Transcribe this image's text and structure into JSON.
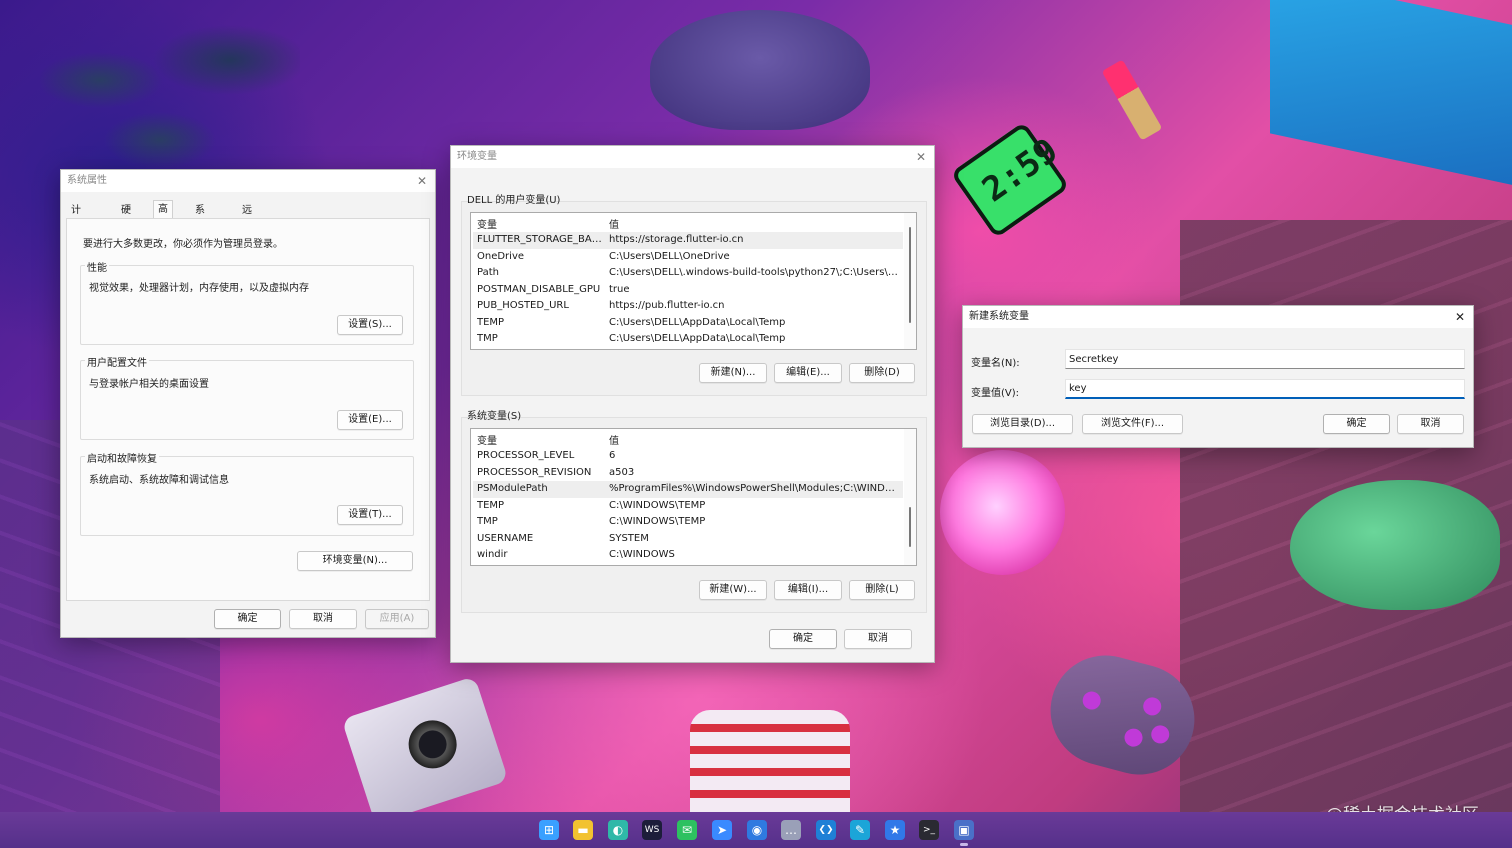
{
  "wallpaper": {
    "clock_text": "2:59",
    "watermark": "@稀土掘金技术社区"
  },
  "system_properties": {
    "title": "系统属性",
    "close_glyph": "✕",
    "tabs": [
      "计算机名",
      "硬件",
      "高级",
      "系统保护",
      "远程"
    ],
    "selected_tab": "高级",
    "admin_notice": "要进行大多数更改，你必须作为管理员登录。",
    "groups": [
      {
        "legend": "性能",
        "description": "视觉效果，处理器计划，内存使用，以及虚拟内存",
        "button": "设置(S)..."
      },
      {
        "legend": "用户配置文件",
        "description": "与登录帐户相关的桌面设置",
        "button": "设置(E)..."
      },
      {
        "legend": "启动和故障恢复",
        "description": "系统启动、系统故障和调试信息",
        "button": "设置(T)..."
      }
    ],
    "env_button": "环境变量(N)...",
    "ok": "确定",
    "cancel": "取消",
    "apply": "应用(A)"
  },
  "env_vars": {
    "title": "环境变量",
    "close_glyph": "✕",
    "user_section_label": "DELL 的用户变量(U)",
    "system_section_label": "系统变量(S)",
    "col_name": "变量",
    "col_value": "值",
    "user_vars": [
      {
        "name": "FLUTTER_STORAGE_BASE_...",
        "value": "https://storage.flutter-io.cn"
      },
      {
        "name": "OneDrive",
        "value": "C:\\Users\\DELL\\OneDrive"
      },
      {
        "name": "Path",
        "value": "C:\\Users\\DELL\\.windows-build-tools\\python27\\;C:\\Users\\DELL..."
      },
      {
        "name": "POSTMAN_DISABLE_GPU",
        "value": "true"
      },
      {
        "name": "PUB_HOSTED_URL",
        "value": "https://pub.flutter-io.cn"
      },
      {
        "name": "TEMP",
        "value": "C:\\Users\\DELL\\AppData\\Local\\Temp"
      },
      {
        "name": "TMP",
        "value": "C:\\Users\\DELL\\AppData\\Local\\Temp"
      }
    ],
    "system_vars": [
      {
        "name": "PROCESSOR_LEVEL",
        "value": "6"
      },
      {
        "name": "PROCESSOR_REVISION",
        "value": "a503"
      },
      {
        "name": "PSModulePath",
        "value": "%ProgramFiles%\\WindowsPowerShell\\Modules;C:\\WINDOW..."
      },
      {
        "name": "TEMP",
        "value": "C:\\WINDOWS\\TEMP"
      },
      {
        "name": "TMP",
        "value": "C:\\WINDOWS\\TEMP"
      },
      {
        "name": "USERNAME",
        "value": "SYSTEM"
      },
      {
        "name": "windir",
        "value": "C:\\WINDOWS"
      }
    ],
    "user_buttons": {
      "new": "新建(N)...",
      "edit": "编辑(E)...",
      "delete": "删除(D)"
    },
    "system_buttons": {
      "new": "新建(W)...",
      "edit": "编辑(I)...",
      "delete": "删除(L)"
    },
    "ok": "确定",
    "cancel": "取消"
  },
  "new_var": {
    "title": "新建系统变量",
    "close_glyph": "✕",
    "name_label": "变量名(N):",
    "value_label": "变量值(V):",
    "name_value": "Secretkey",
    "value_value": "key",
    "browse_dir": "浏览目录(D)...",
    "browse_file": "浏览文件(F)...",
    "ok": "确定",
    "cancel": "取消"
  },
  "taskbar": {
    "icons": [
      {
        "name": "windows-start-icon",
        "glyph": "⊞",
        "color": "#3aa0ff"
      },
      {
        "name": "file-explorer-icon",
        "glyph": "▬",
        "color": "#f2c230"
      },
      {
        "name": "edge-browser-icon",
        "glyph": "◐",
        "color": "#2fb8a8"
      },
      {
        "name": "webstorm-icon",
        "glyph": "WS",
        "color": "#1d1d3a"
      },
      {
        "name": "wechat-icon",
        "glyph": "✉",
        "color": "#2dc160"
      },
      {
        "name": "feishu-icon",
        "glyph": "➤",
        "color": "#3a8aff"
      },
      {
        "name": "location-app-icon",
        "glyph": "◉",
        "color": "#2f7ae0"
      },
      {
        "name": "chat-bubble-icon",
        "glyph": "…",
        "color": "#9aa0b8"
      },
      {
        "name": "vscode-icon",
        "glyph": "❮❯",
        "color": "#1f80d6"
      },
      {
        "name": "notes-app-icon",
        "glyph": "✎",
        "color": "#1ba5d8"
      },
      {
        "name": "star-app-icon",
        "glyph": "★",
        "color": "#3178e8"
      },
      {
        "name": "terminal-icon",
        "glyph": ">_",
        "color": "#2a2a32"
      },
      {
        "name": "control-panel-icon",
        "glyph": "▣",
        "color": "#4a70c8"
      }
    ]
  }
}
